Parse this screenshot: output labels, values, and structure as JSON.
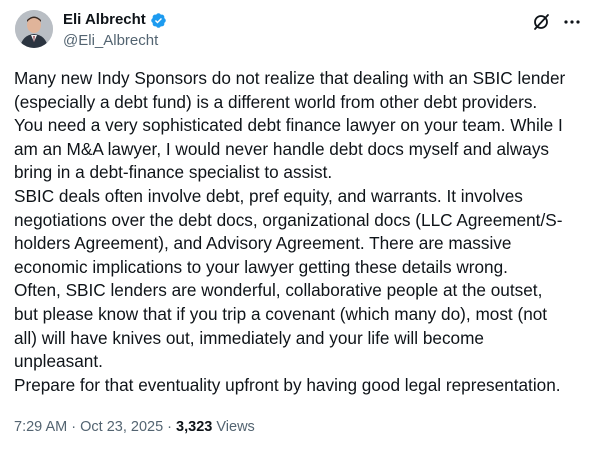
{
  "author": {
    "name": "Eli Albrecht",
    "handle": "@Eli_Albrecht",
    "verified_color": "#1d9bf0"
  },
  "icons": {
    "verified": "verified-badge-icon",
    "grok": "grok-icon",
    "more": "more-options-icon"
  },
  "tweet": {
    "lines": [
      "Many new Indy Sponsors do not realize that dealing with an SBIC lender",
      "(especially a debt fund) is a different world from other debt providers.",
      "You need a very sophisticated debt finance lawyer on your team. While I",
      "am an M&A lawyer, I would never handle debt docs myself and always",
      "bring in a debt-finance specialist to assist.",
      "SBIC deals often involve debt, pref equity, and warrants. It involves",
      "negotiations over the debt docs, organizational docs (LLC Agreement/S-",
      "holders Agreement), and Advisory Agreement. There are massive",
      "economic implications to your lawyer getting these details wrong.",
      "Often, SBIC lenders are wonderful, collaborative people at the outset,",
      "but please know that if you trip a covenant (which many do), most (not",
      "all) will have knives out, immediately and your life will become",
      "unpleasant.",
      "Prepare for that eventuality upfront by having good legal representation."
    ]
  },
  "meta": {
    "time": "7:29 AM",
    "separator": "·",
    "date": "Oct 23, 2025",
    "views_count": "3,323",
    "views_label": "Views"
  }
}
